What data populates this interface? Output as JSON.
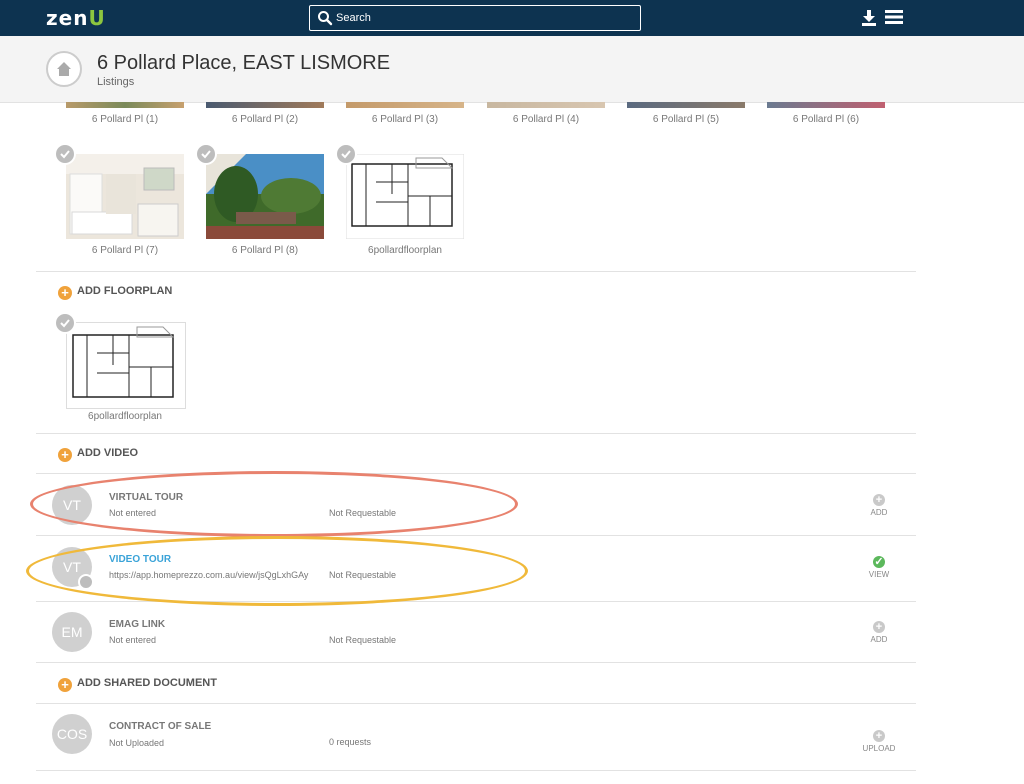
{
  "app": {
    "logo_text": "zen",
    "logo_accent": "U"
  },
  "search": {
    "placeholder": "Search"
  },
  "header": {
    "title": "6 Pollard Place, EAST LISMORE",
    "subtitle": "Listings"
  },
  "photos_row1": [
    "6 Pollard Pl (1)",
    "6 Pollard Pl (2)",
    "6 Pollard Pl (3)",
    "6 Pollard Pl (4)",
    "6 Pollard Pl (5)",
    "6 Pollard Pl (6)"
  ],
  "photos_row2": [
    "6 Pollard Pl (7)",
    "6 Pollard Pl (8)",
    "6pollardfloorplan"
  ],
  "floorplan": {
    "add_label": "ADD FLOORPLAN",
    "caption": "6pollardfloorplan"
  },
  "video": {
    "add_label": "ADD VIDEO"
  },
  "rows": [
    {
      "initials": "VT",
      "title": "VIRTUAL TOUR",
      "status": "Not entered",
      "request": "Not Requestable",
      "action": "ADD"
    },
    {
      "initials": "VT",
      "title": "VIDEO TOUR",
      "status": "https://app.homeprezzo.com.au/view/jsQgLxhGAy",
      "request": "Not Requestable",
      "action": "VIEW"
    },
    {
      "initials": "EM",
      "title": "EMAG LINK",
      "status": "Not entered",
      "request": "Not Requestable",
      "action": "ADD"
    }
  ],
  "shared_doc": {
    "add_label": "ADD SHARED DOCUMENT"
  },
  "doc_row": {
    "initials": "COS",
    "title": "CONTRACT OF SALE",
    "status": "Not Uploaded",
    "request": "0 requests",
    "action": "UPLOAD"
  },
  "colors": {
    "topbar": "#0d3350",
    "accent_orange": "#f0a23b",
    "link_blue": "#3aa3d8",
    "ok_green": "#5cb85c",
    "ellipse_red": "#e8826e",
    "ellipse_yellow": "#f0b93a"
  }
}
